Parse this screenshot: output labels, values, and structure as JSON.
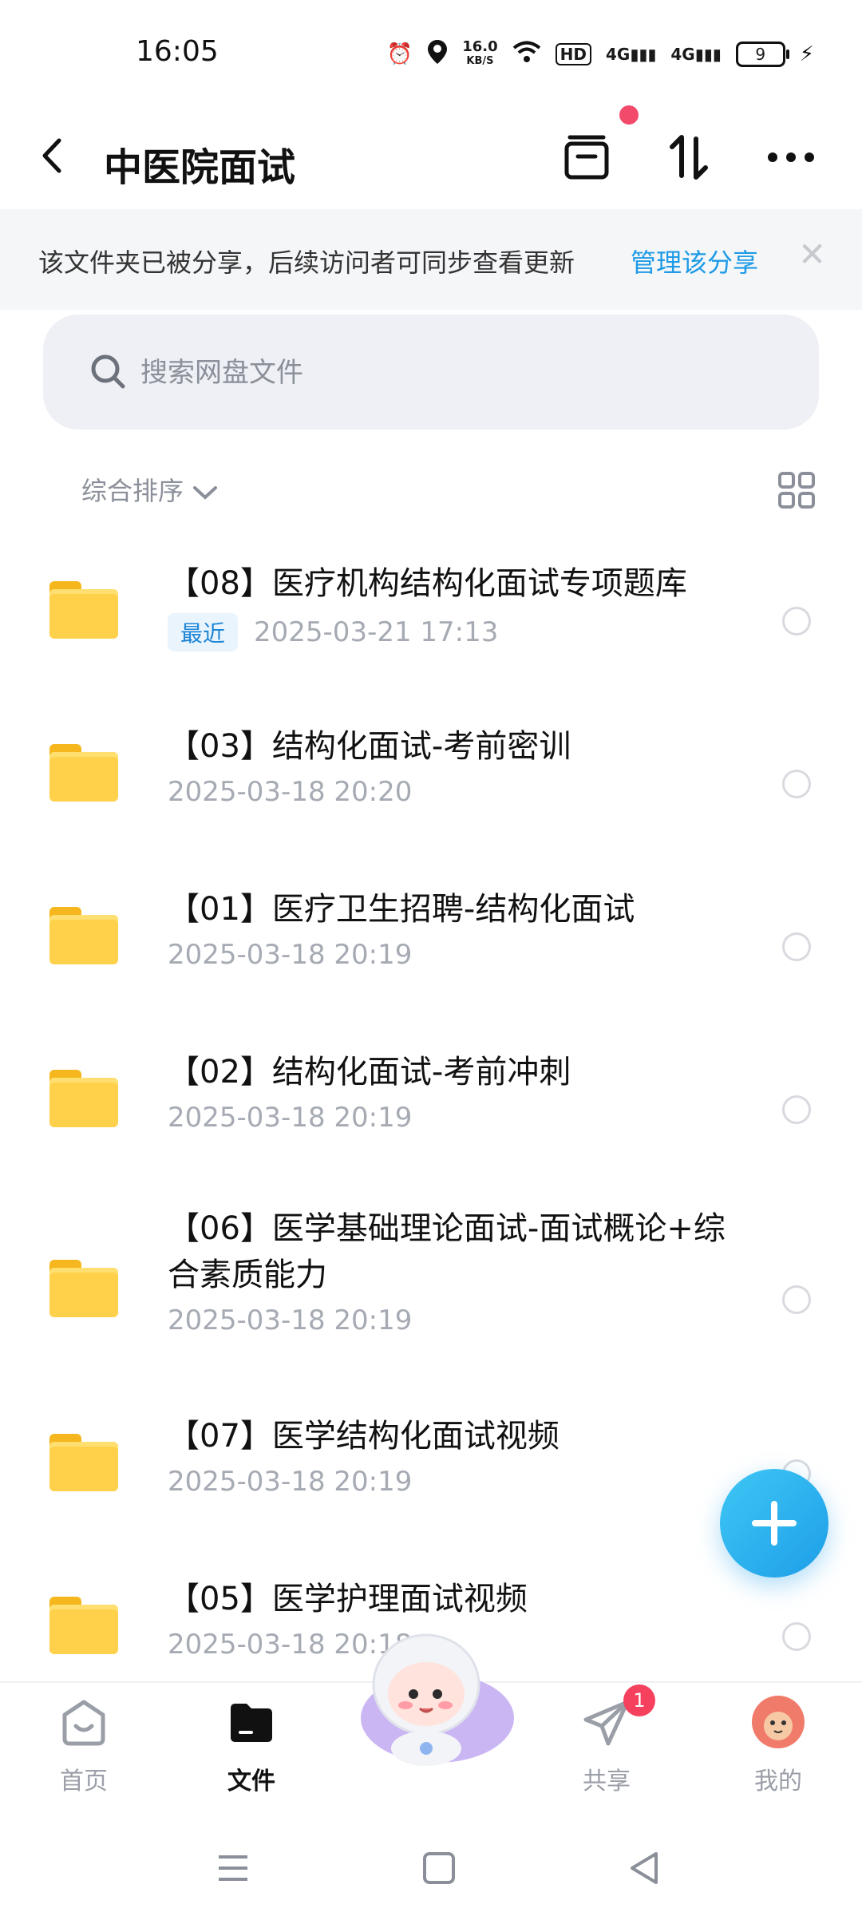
{
  "status_bar": {
    "time": "16:05",
    "net_speed_value": "16.0",
    "net_speed_unit": "KB/S",
    "hd_label": "HD",
    "signal_1": "4G",
    "signal_2": "4G",
    "battery": "9"
  },
  "header": {
    "title": "中医院面试"
  },
  "banner": {
    "text": "该文件夹已被分享，后续访问者可同步查看更新",
    "link": "管理该分享"
  },
  "search": {
    "placeholder": "搜索网盘文件"
  },
  "sort": {
    "label": "综合排序"
  },
  "files": [
    {
      "name": "【08】医疗机构结构化面试专项题库",
      "tag": "最近",
      "date": "2025-03-21  17:13"
    },
    {
      "name": "【03】结构化面试-考前密训",
      "date": "2025-03-18  20:20"
    },
    {
      "name": "【01】医疗卫生招聘-结构化面试",
      "date": "2025-03-18  20:19"
    },
    {
      "name": "【02】结构化面试-考前冲刺",
      "date": "2025-03-18  20:19"
    },
    {
      "name": "【06】医学基础理论面试-面试概论+综合素质能力",
      "date": "2025-03-18  20:19"
    },
    {
      "name": "【07】医学结构化面试视频",
      "date": "2025-03-18  20:19"
    },
    {
      "name": "【05】医学护理面试视频",
      "date": "2025-03-18  20:18"
    }
  ],
  "bottom_nav": {
    "home": "首页",
    "files": "文件",
    "share": "共享",
    "share_badge": "1",
    "me": "我的"
  },
  "colors": {
    "accent": "#1e9be6",
    "folder": "#ffd04a",
    "badge": "#f5405e"
  }
}
